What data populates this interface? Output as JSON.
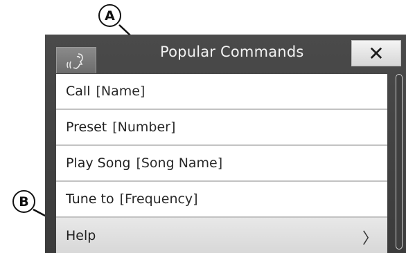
{
  "callouts": {
    "a": "A",
    "b": "B"
  },
  "dialog": {
    "title": "Popular Commands",
    "close_label": "✕",
    "mic_icon": "voice-command-icon"
  },
  "commands": [
    {
      "label": "Call",
      "param": "[Name]"
    },
    {
      "label": "Preset",
      "param": "[Number]"
    },
    {
      "label": "Play Song",
      "param": "[Song Name]"
    },
    {
      "label": "Tune to",
      "param": "[Frequency]"
    }
  ],
  "help": {
    "label": "Help",
    "chevron": "〉"
  },
  "colors": {
    "frame": "#444444",
    "list_bg": "#ffffff",
    "help_bg": "#e0e0e0",
    "close_bg": "#e8e8e8"
  }
}
